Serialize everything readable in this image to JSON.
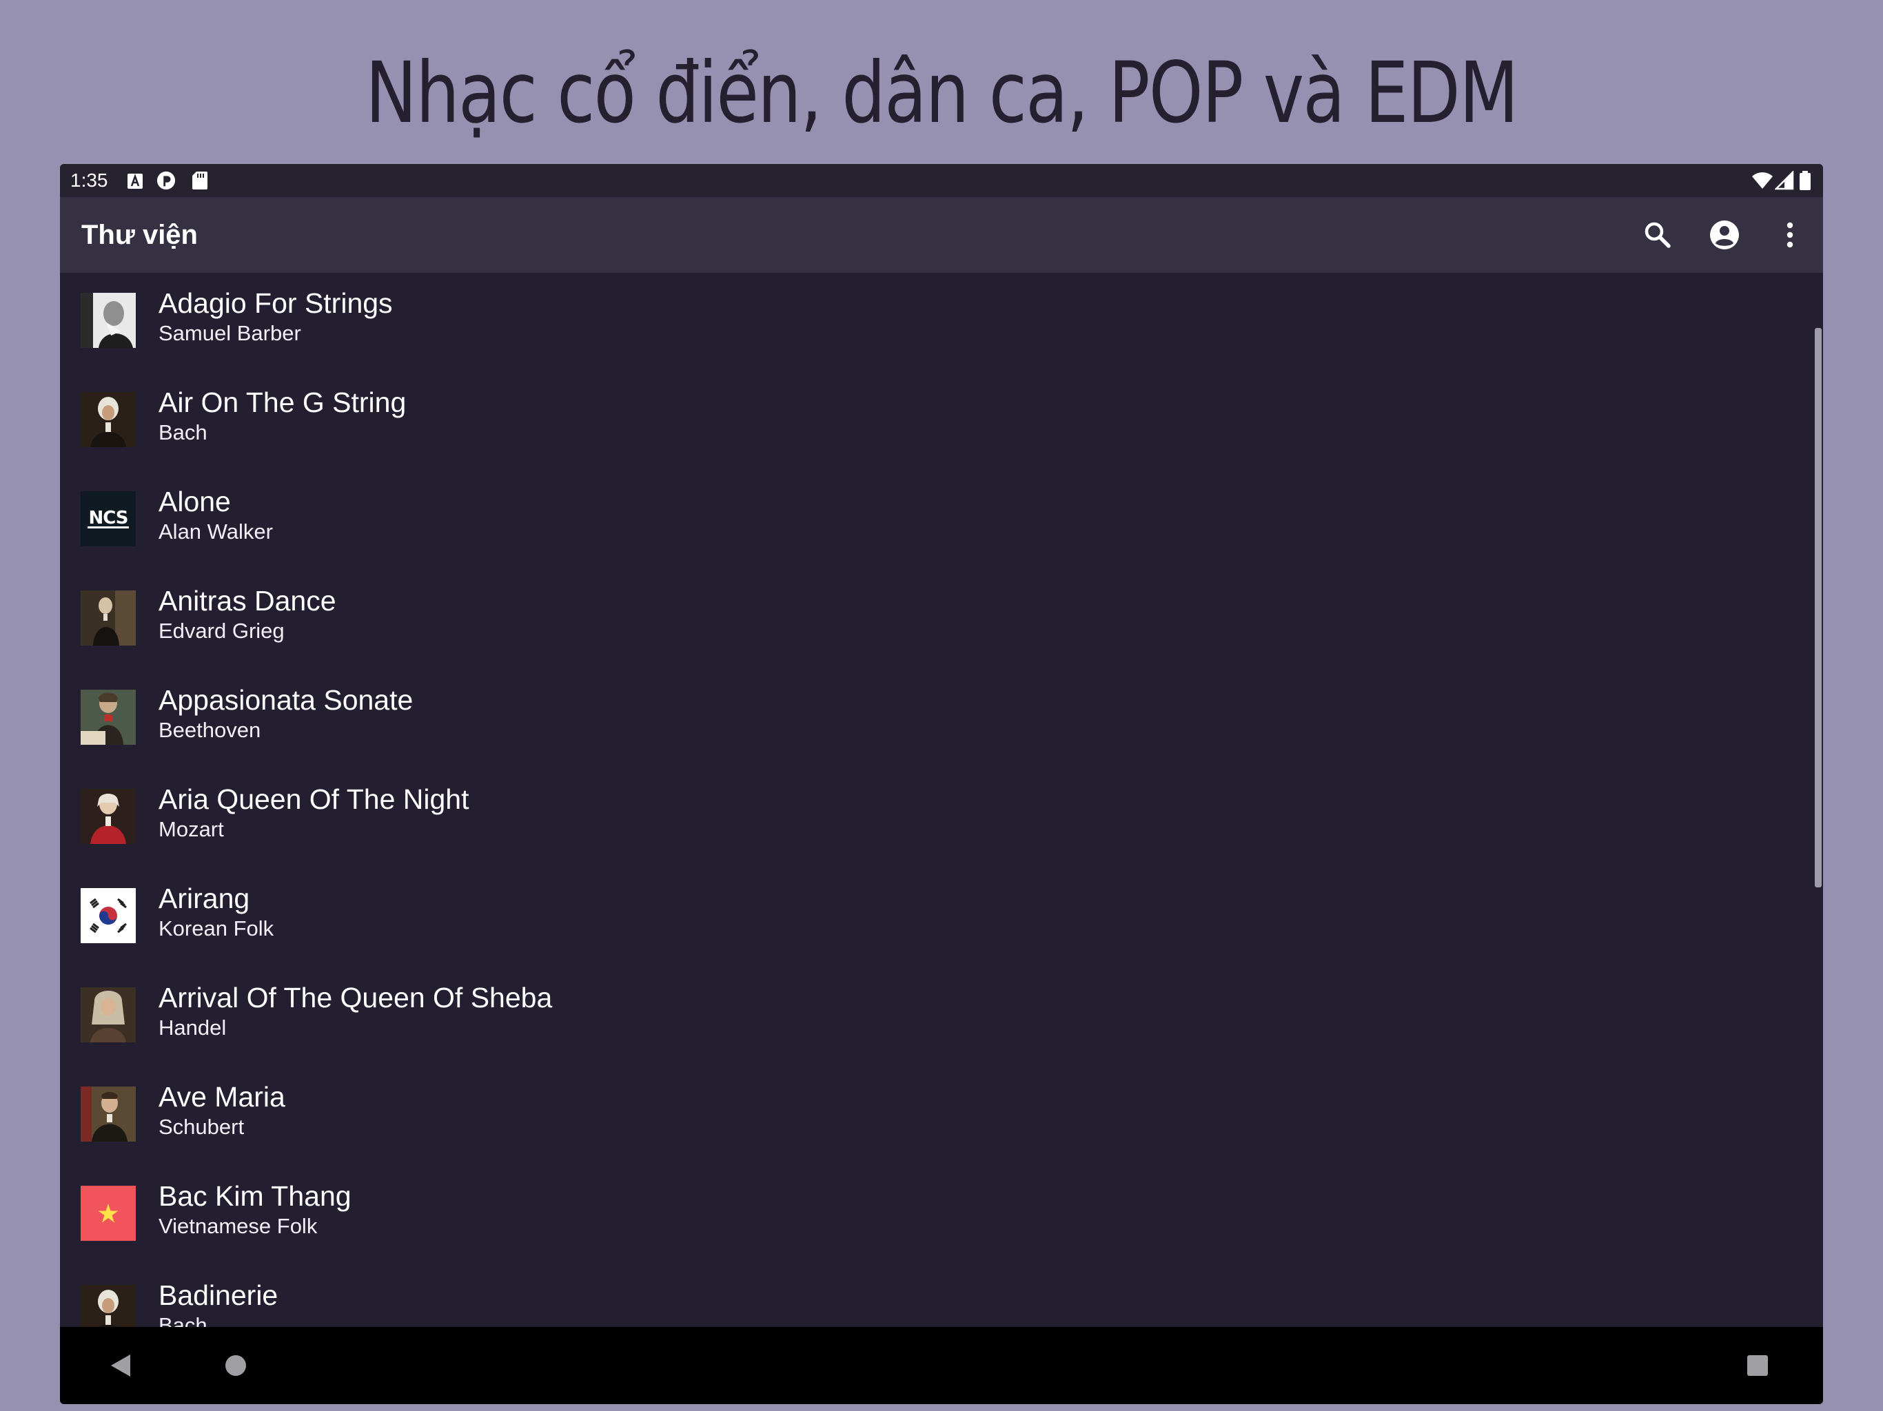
{
  "headline": "Nhạc cổ điển, dân ca, POP và EDM",
  "status_bar": {
    "time": "1:35",
    "icons": [
      "text-a-icon",
      "sync-circle-icon",
      "sd-card-icon",
      "wifi-icon",
      "signal-icon",
      "battery-icon"
    ]
  },
  "app_bar": {
    "title": "Thư viện",
    "icons": [
      "search-icon",
      "account-circle-icon",
      "more-vert-icon"
    ]
  },
  "songs": [
    {
      "title": "Adagio For Strings",
      "artist": "Samuel Barber",
      "art": "portrait-bw"
    },
    {
      "title": "Air On The G String",
      "artist": "Bach",
      "art": "portrait-bach"
    },
    {
      "title": "Alone",
      "artist": "Alan Walker",
      "art": "ncs-logo"
    },
    {
      "title": "Anitras Dance",
      "artist": "Edvard Grieg",
      "art": "portrait-grieg"
    },
    {
      "title": "Appasionata Sonate",
      "artist": "Beethoven",
      "art": "portrait-beethoven"
    },
    {
      "title": "Aria Queen Of The Night",
      "artist": "Mozart",
      "art": "portrait-mozart"
    },
    {
      "title": "Arirang",
      "artist": "Korean Folk",
      "art": "flag-korea"
    },
    {
      "title": "Arrival Of The Queen Of Sheba",
      "artist": "Handel",
      "art": "portrait-handel"
    },
    {
      "title": "Ave Maria",
      "artist": "Schubert",
      "art": "portrait-schubert"
    },
    {
      "title": "Bac Kim Thang",
      "artist": "Vietnamese Folk",
      "art": "flag-vietnam"
    },
    {
      "title": "Badinerie",
      "artist": "Bach",
      "art": "portrait-bach"
    }
  ],
  "nav_bar": {
    "icons": [
      "back-icon",
      "home-icon",
      "recents-icon"
    ]
  },
  "colors": {
    "page_background": "#9690b1",
    "app_background": "#241e31",
    "app_bar": "#353143",
    "status_bar": "#26222f",
    "nav_bar": "#000000",
    "text_primary": "#ffffff",
    "headline_text": "#25202f"
  }
}
